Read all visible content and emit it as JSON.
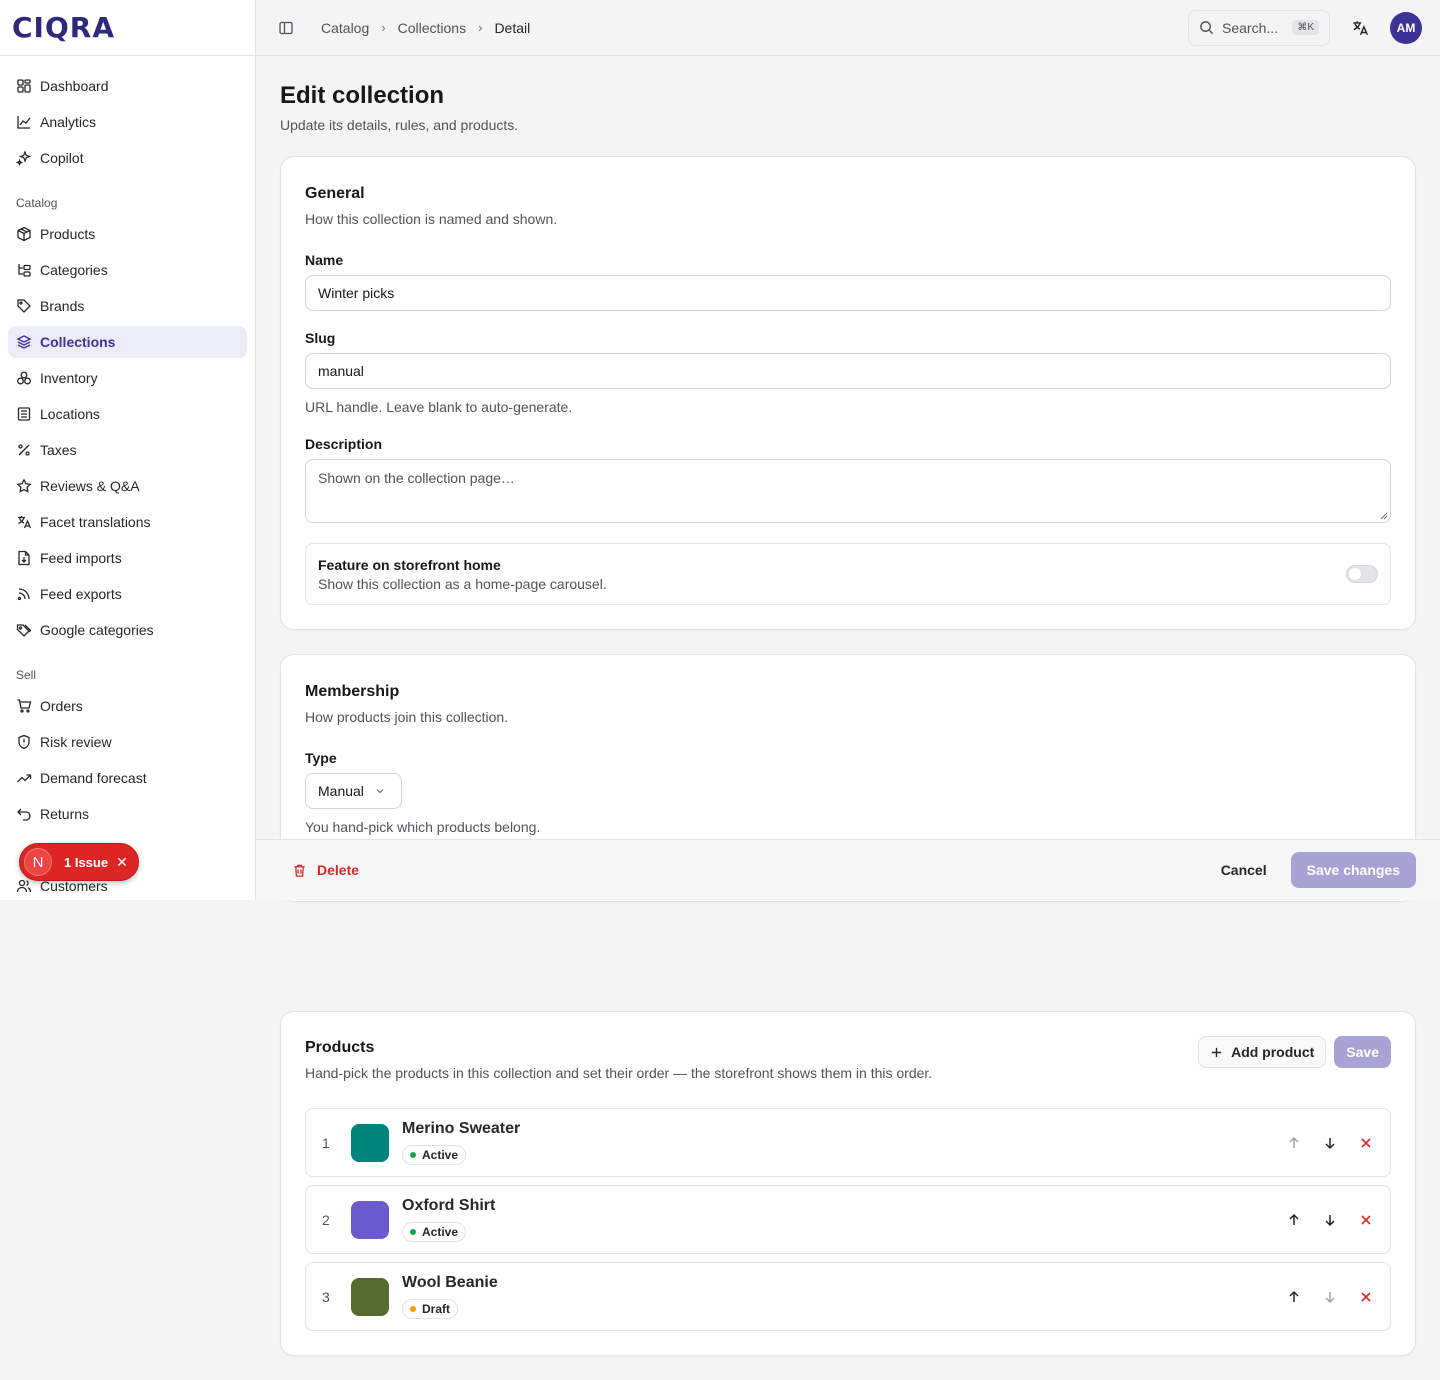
{
  "app": {
    "logo": "CIQRA"
  },
  "sidebar": {
    "items_top": [
      {
        "label": "Dashboard",
        "icon": "grid-icon"
      },
      {
        "label": "Analytics",
        "icon": "line-chart-icon"
      },
      {
        "label": "Copilot",
        "icon": "sparkles-icon"
      }
    ],
    "catalog_heading": "Catalog",
    "catalog_items": [
      {
        "label": "Products",
        "icon": "package-icon"
      },
      {
        "label": "Categories",
        "icon": "folder-tree-icon"
      },
      {
        "label": "Brands",
        "icon": "tag-icon"
      },
      {
        "label": "Collections",
        "icon": "layers-icon",
        "active": true
      },
      {
        "label": "Inventory",
        "icon": "boxes-icon"
      },
      {
        "label": "Locations",
        "icon": "building-icon"
      },
      {
        "label": "Taxes",
        "icon": "percent-icon"
      },
      {
        "label": "Reviews & Q&A",
        "icon": "star-icon"
      },
      {
        "label": "Facet translations",
        "icon": "translate-icon"
      },
      {
        "label": "Feed imports",
        "icon": "file-import-icon"
      },
      {
        "label": "Feed exports",
        "icon": "rss-icon"
      },
      {
        "label": "Google categories",
        "icon": "tag-icon"
      }
    ],
    "sell_heading": "Sell",
    "sell_items": [
      {
        "label": "Orders",
        "icon": "cart-icon"
      },
      {
        "label": "Risk review",
        "icon": "shield-icon"
      },
      {
        "label": "Demand forecast",
        "icon": "trend-up-icon"
      },
      {
        "label": "Returns",
        "icon": "undo-icon"
      },
      {
        "label": "",
        "icon": "hidden-item"
      },
      {
        "label": "Customers",
        "icon": "users-icon"
      }
    ]
  },
  "topbar": {
    "breadcrumb": [
      "Catalog",
      "Collections",
      "Detail"
    ],
    "search_placeholder": "Search...",
    "search_shortcut": "⌘K",
    "avatar_initials": "AM"
  },
  "page": {
    "title": "Edit collection",
    "subtitle": "Update its details, rules, and products."
  },
  "general": {
    "title": "General",
    "description": "How this collection is named and shown.",
    "name_label": "Name",
    "name_value": "Winter picks",
    "slug_label": "Slug",
    "slug_value": "manual",
    "slug_hint": "URL handle. Leave blank to auto-generate.",
    "description_label": "Description",
    "description_placeholder": "Shown on the collection page…",
    "feature_title": "Feature on storefront home",
    "feature_desc": "Show this collection as a home-page carousel.",
    "feature_enabled": false
  },
  "membership": {
    "title": "Membership",
    "description": "How products join this collection.",
    "type_label": "Type",
    "type_value": "Manual",
    "type_hint": "You hand-pick which products belong."
  },
  "actionbar": {
    "delete_label": "Delete",
    "cancel_label": "Cancel",
    "save_label": "Save changes"
  },
  "issue": {
    "avatar_letter": "N",
    "label": "1 Issue"
  },
  "products": {
    "title": "Products",
    "description": "Hand-pick the products in this collection and set their order — the storefront shows them in this order.",
    "add_label": "Add product",
    "save_label": "Save",
    "rows": [
      {
        "index": "1",
        "name": "Merino Sweater",
        "status": "Active",
        "status_color": "#16a34a",
        "swatch": "#00857d",
        "can_up": false,
        "can_down": true
      },
      {
        "index": "2",
        "name": "Oxford Shirt",
        "status": "Active",
        "status_color": "#16a34a",
        "swatch": "#6a5acd",
        "can_up": true,
        "can_down": true
      },
      {
        "index": "3",
        "name": "Wool Beanie",
        "status": "Draft",
        "status_color": "#f59e0b",
        "swatch": "#556b2f",
        "can_up": true,
        "can_down": false
      }
    ]
  },
  "colors": {
    "brand": "#2e2a7a",
    "accent": "#3b3395",
    "danger": "#dc2626",
    "disabled_primary": "#a7a3d4"
  }
}
